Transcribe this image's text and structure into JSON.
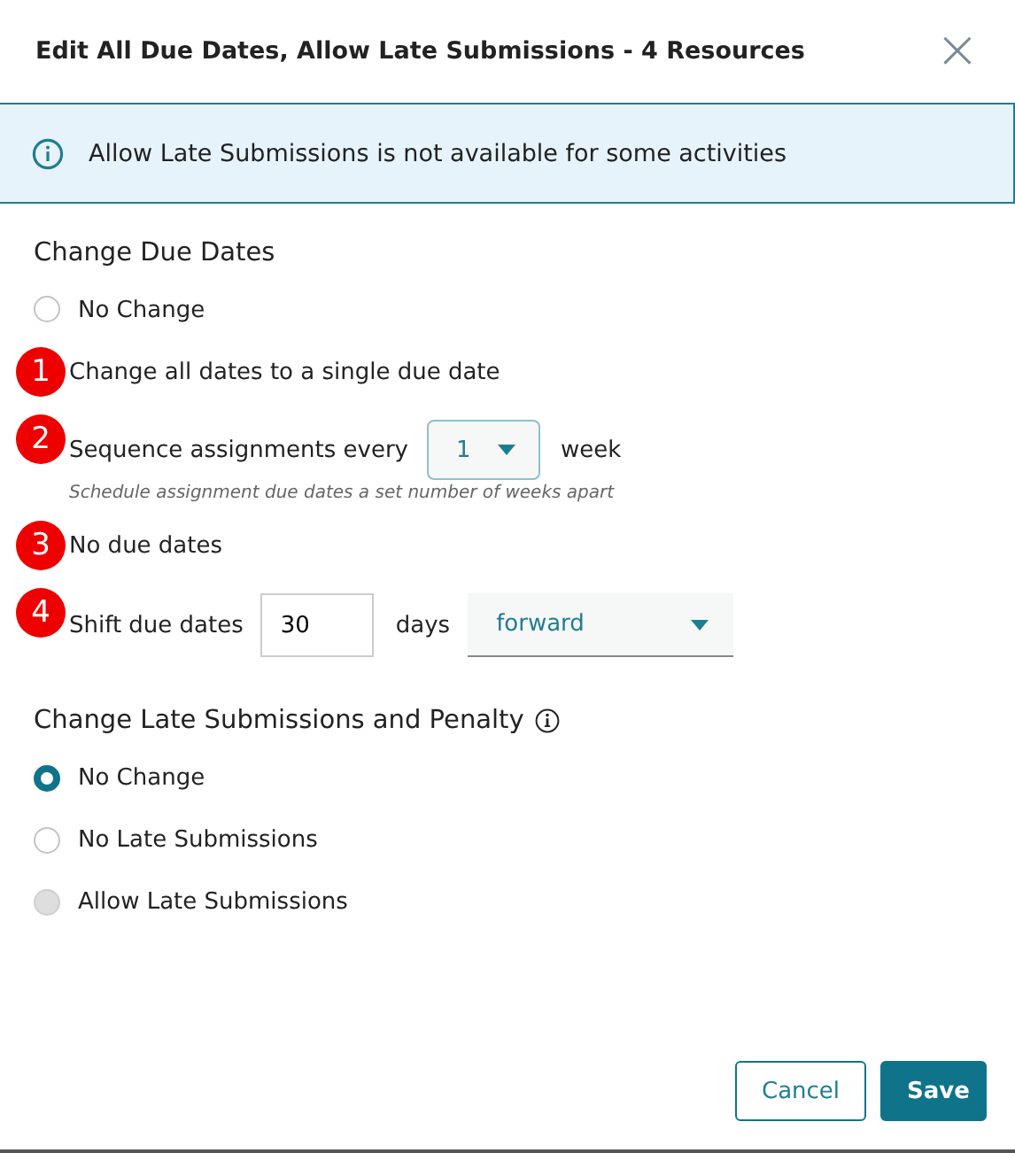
{
  "dialog": {
    "title": "Edit All Due Dates, Allow Late Submissions - 4 Resources",
    "close_label": "×"
  },
  "banner": {
    "text": "Allow Late Submissions is not available for some activities"
  },
  "due_dates": {
    "heading": "Change Due Dates",
    "options": [
      {
        "kind": "radio",
        "label": "No Change",
        "selected": false
      },
      {
        "kind": "marker",
        "marker": "1",
        "label": "Change all dates to a single due date"
      },
      {
        "kind": "marker",
        "marker": "2",
        "label": "Sequence assignments every",
        "select": "1",
        "suffix": "week",
        "hint": "Schedule assignment due dates a set number of weeks apart"
      },
      {
        "kind": "marker",
        "marker": "3",
        "label": "No due dates"
      },
      {
        "kind": "marker",
        "marker": "4",
        "label": "Shift due dates",
        "input": "30",
        "suffix": "days",
        "dropdown": "forward"
      }
    ]
  },
  "late": {
    "heading": "Change Late Submissions and Penalty",
    "options": [
      {
        "label": "No Change",
        "selected": true,
        "disabled": false
      },
      {
        "label": "No Late Submissions",
        "selected": false,
        "disabled": false
      },
      {
        "label": "Allow Late Submissions",
        "selected": false,
        "disabled": true
      }
    ]
  },
  "buttons": [
    {
      "label": "Cancel",
      "kind": "secondary"
    },
    {
      "label": "Save",
      "kind": "primary"
    }
  ]
}
